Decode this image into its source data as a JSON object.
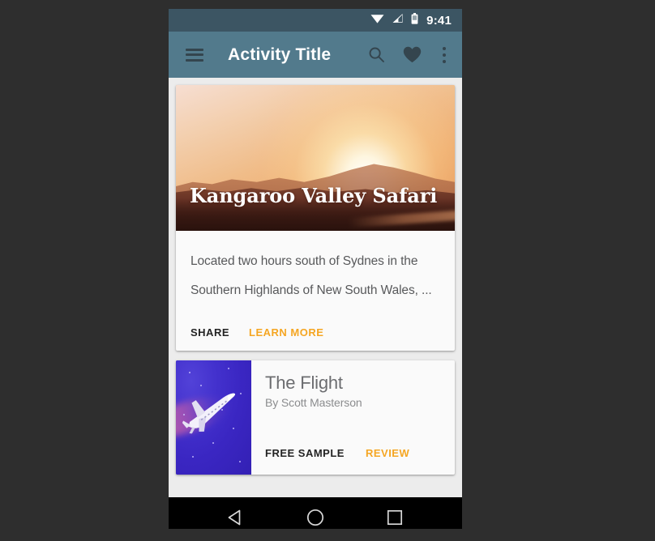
{
  "status_bar": {
    "time": "9:41",
    "icons": [
      "wifi-icon",
      "signal-icon",
      "battery-icon"
    ]
  },
  "app_bar": {
    "title": "Activity Title",
    "menu_icon": "hamburger-menu-icon",
    "actions": [
      {
        "name": "search-icon",
        "label": "Search"
      },
      {
        "name": "favorite-heart-icon",
        "label": "Favorite"
      },
      {
        "name": "overflow-menu-icon",
        "label": "More options"
      }
    ]
  },
  "cards": {
    "travel": {
      "image_alt": "sunset-landscape-image",
      "title": "Kangaroo Valley Safari",
      "body": "Located two hours south of Sydnes in the Southern Highlands of New South Wales, ...",
      "actions": {
        "primary": "SHARE",
        "secondary": "LEARN MORE"
      }
    },
    "book": {
      "cover_alt": "airplane-space-cover-image",
      "title": "The Flight",
      "author": "By Scott Masterson",
      "actions": {
        "primary": "FREE SAMPLE",
        "secondary": "REVIEW"
      }
    }
  },
  "nav_bar": {
    "back": "back-triangle-icon",
    "home": "home-circle-icon",
    "recents": "recents-square-icon"
  },
  "colors": {
    "status_bar": "#3c5563",
    "app_bar": "#527a8c",
    "accent": "#f5a623",
    "page_background": "#2e2e2e",
    "content_background": "#ececec",
    "card_background": "#fafafa"
  }
}
